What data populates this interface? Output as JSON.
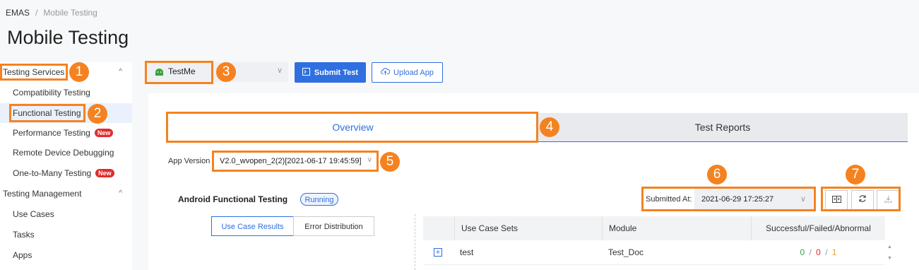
{
  "breadcrumb": {
    "root": "EMAS",
    "separator": "/",
    "current": "Mobile Testing"
  },
  "page_title": "Mobile Testing",
  "sidebar": {
    "items": [
      {
        "label": "Testing Services",
        "type": "group"
      },
      {
        "label": "Compatibility Testing",
        "type": "sub"
      },
      {
        "label": "Functional Testing",
        "type": "sub",
        "active": true
      },
      {
        "label": "Performance Testing",
        "type": "sub",
        "badge": "New"
      },
      {
        "label": "Remote Device Debugging",
        "type": "sub"
      },
      {
        "label": "One-to-Many Testing",
        "type": "sub",
        "badge": "New"
      },
      {
        "label": "Testing Management",
        "type": "group"
      },
      {
        "label": "Use Cases",
        "type": "sub"
      },
      {
        "label": "Tasks",
        "type": "sub"
      },
      {
        "label": "Apps",
        "type": "sub"
      }
    ]
  },
  "toolbar": {
    "app_name": "TestMe",
    "app_icon": "android-icon",
    "submit_label": "Submit Test",
    "upload_label": "Upload App"
  },
  "tabs": [
    {
      "label": "Overview",
      "active": true
    },
    {
      "label": "Test Reports",
      "active": false
    }
  ],
  "app_version": {
    "label": "App Version",
    "value": "V2.0_wvopen_2(2)[2021-06-17 19:45:59]"
  },
  "section": {
    "title": "Android Functional Testing",
    "status": "Running"
  },
  "result_tabs": [
    {
      "label": "Use Case Results",
      "active": true
    },
    {
      "label": "Error Distribution",
      "active": false
    }
  ],
  "submitted": {
    "label": "Submitted At:",
    "value": "2021-06-29 17:25:27"
  },
  "icon_buttons": [
    "report-icon",
    "refresh-icon",
    "download-icon"
  ],
  "table": {
    "columns": [
      "Use Case Sets",
      "Module",
      "Successful/Failed/Abnormal"
    ],
    "rows": [
      {
        "set": "test",
        "module": "Test_Doc",
        "success": "0",
        "failed": "0",
        "abnormal": "1",
        "sep": "/"
      }
    ]
  },
  "callouts": [
    "1",
    "2",
    "3",
    "4",
    "5",
    "6",
    "7"
  ],
  "colors": {
    "accent": "#2f6fe0",
    "highlight": "#f58220",
    "success": "#3aa33a",
    "failed": "#e22b2b",
    "abnormal": "#e6a23c"
  }
}
